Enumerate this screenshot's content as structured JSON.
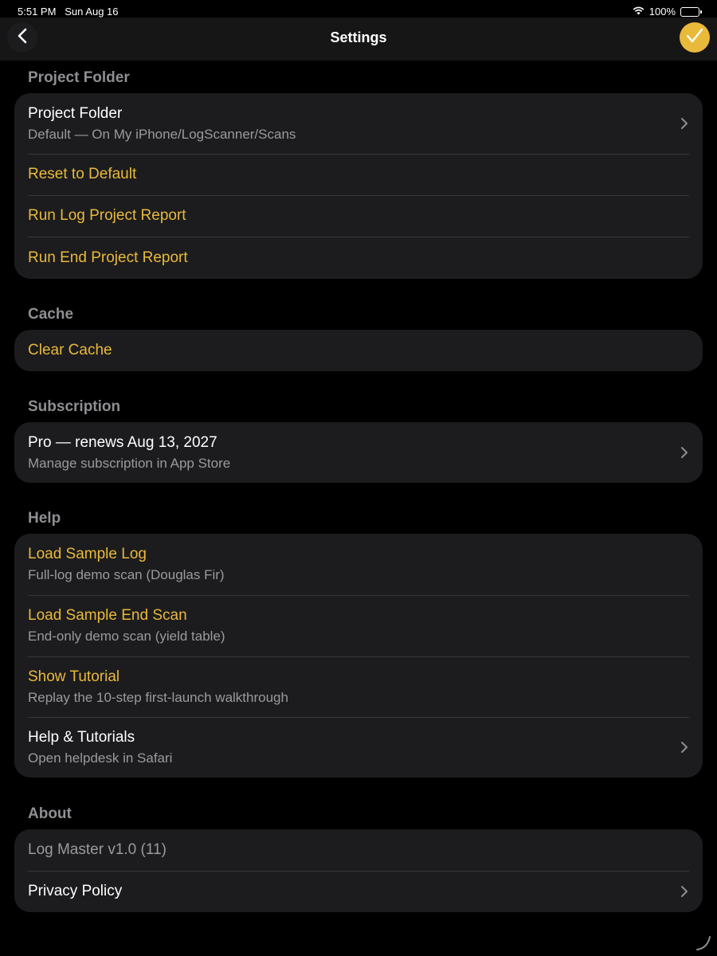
{
  "status_bar": {
    "time": "5:51 PM",
    "date": "Sun Aug 16",
    "battery": "100%"
  },
  "nav": {
    "title": "Settings",
    "back_icon": "chevron-left-icon",
    "done_icon": "checkmark-icon"
  },
  "colors": {
    "accent": "#e9b93a",
    "background": "#000000",
    "group_bg": "#1c1c1e",
    "secondary_text": "#9a9a9f"
  },
  "sections": {
    "project_folder": {
      "header": "Project Folder",
      "rows": [
        {
          "title": "Project Folder",
          "subtitle": "Default — On My iPhone/LogScanner/Scans"
        },
        {
          "title": "Reset to Default"
        },
        {
          "title": "Run Log Project Report"
        },
        {
          "title": "Run End Project Report"
        }
      ]
    },
    "cache": {
      "header": "Cache",
      "rows": [
        {
          "title": "Clear Cache"
        }
      ]
    },
    "subscription": {
      "header": "Subscription",
      "rows": [
        {
          "title": "Pro — renews Aug 13, 2027",
          "subtitle": "Manage subscription in App Store"
        }
      ]
    },
    "help": {
      "header": "Help",
      "rows": [
        {
          "title": "Load Sample Log",
          "subtitle": "Full-log demo scan (Douglas Fir)"
        },
        {
          "title": "Load Sample End Scan",
          "subtitle": "End-only demo scan (yield table)"
        },
        {
          "title": "Show Tutorial",
          "subtitle": "Replay the 10-step first-launch walkthrough"
        },
        {
          "title": "Help & Tutorials",
          "subtitle": "Open helpdesk in Safari"
        }
      ]
    },
    "about": {
      "header": "About",
      "rows": [
        {
          "title": "Log Master v1.0 (11)"
        },
        {
          "title": "Privacy Policy"
        }
      ]
    }
  }
}
